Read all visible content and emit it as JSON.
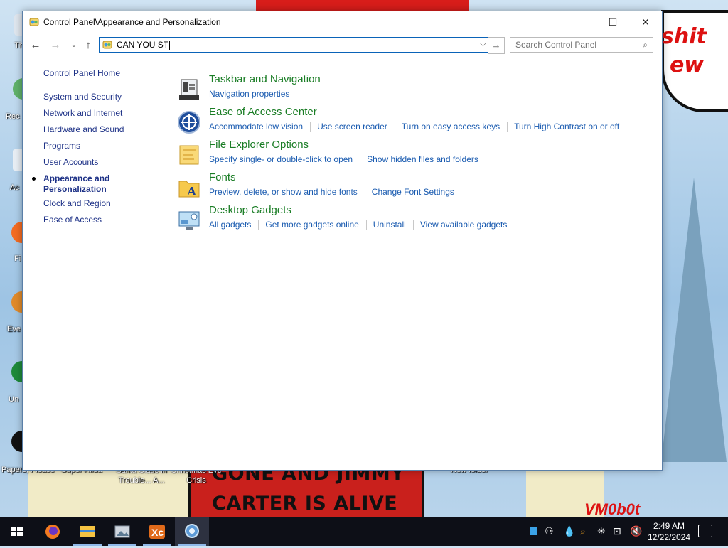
{
  "window": {
    "title": "Control Panel\\Appearance and Personalization",
    "minimize_glyph": "—",
    "maximize_glyph": "☐",
    "close_glyph": "✕"
  },
  "navbar": {
    "address_value": "CAN YOU ST",
    "search_placeholder": "Search Control Panel"
  },
  "sidebar": {
    "items": [
      {
        "label": "Control Panel Home"
      },
      {
        "label": "System and Security"
      },
      {
        "label": "Network and Internet"
      },
      {
        "label": "Hardware and Sound"
      },
      {
        "label": "Programs"
      },
      {
        "label": "User Accounts"
      },
      {
        "label": "Appearance and Personalization",
        "current": true
      },
      {
        "label": "Clock and Region"
      },
      {
        "label": "Ease of Access"
      }
    ]
  },
  "categories": [
    {
      "title": "Taskbar and Navigation",
      "icon": "taskbar-icon",
      "links": [
        "Navigation properties"
      ]
    },
    {
      "title": "Ease of Access Center",
      "icon": "ease-of-access-icon",
      "links": [
        "Accommodate low vision",
        "Use screen reader",
        "Turn on easy access keys",
        "Turn High Contrast on or off"
      ]
    },
    {
      "title": "File Explorer Options",
      "icon": "folder-options-icon",
      "links": [
        "Specify single- or double-click to open",
        "Show hidden files and folders"
      ]
    },
    {
      "title": "Fonts",
      "icon": "fonts-folder-icon",
      "links": [
        "Preview, delete, or show and hide fonts",
        "Change Font Settings"
      ]
    },
    {
      "title": "Desktop Gadgets",
      "icon": "gadgets-icon",
      "links": [
        "All gadgets",
        "Get more gadgets online",
        "Uninstall",
        "View available gadgets"
      ]
    }
  ],
  "desktop": {
    "wallpaper_text_1": "GONE AND JIMMY",
    "wallpaper_text_2": "CARTER IS ALIVE",
    "speech_text": "shit\new",
    "watermark": "VM0b0t",
    "icon_labels": [
      "Th",
      "Rec",
      "Ac",
      "Fi",
      "Eve",
      "Un",
      "Papers, Please",
      "Super Hilda",
      "Santa Claus in Trouble... A...",
      "Christmas Eve Crisis",
      "New folder"
    ]
  },
  "taskbar": {
    "time": "2:49 AM",
    "date": "12/22/2024",
    "apps": [
      "firefox-icon",
      "file-explorer-icon",
      "photos-icon",
      "xc-app-icon",
      "control-panel-icon"
    ]
  },
  "colors": {
    "link": "#1a5bb0",
    "category_title": "#1a7d25",
    "nav_link": "#1e3287",
    "taskbar": "#0d0f17"
  }
}
